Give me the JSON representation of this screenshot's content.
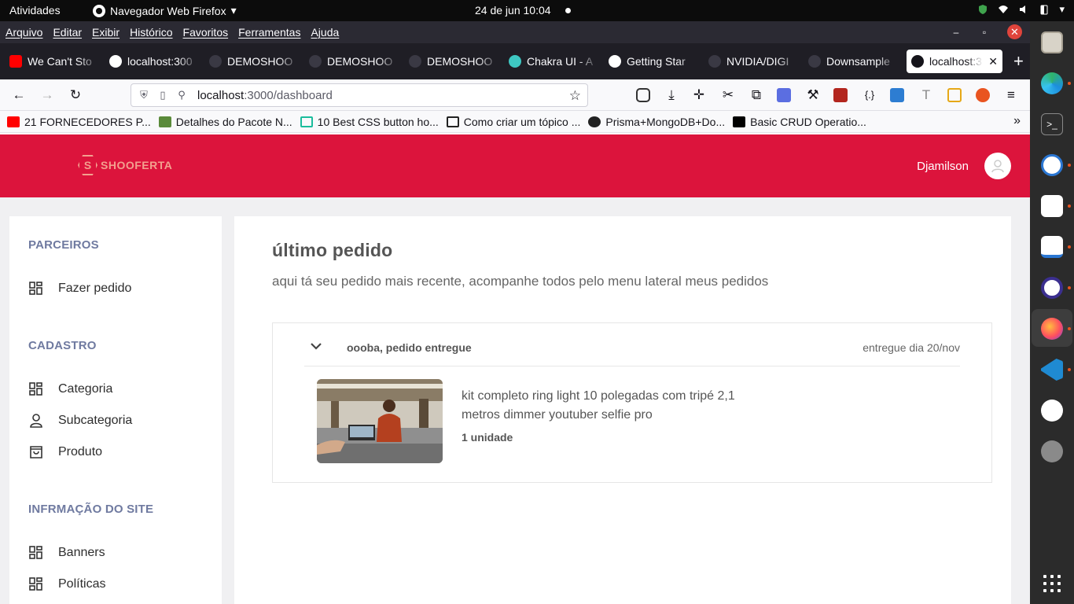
{
  "system": {
    "activities": "Atividades",
    "app_name": "Navegador Web Firefox",
    "clock": "24 de jun  10:04"
  },
  "firefox": {
    "menu": [
      "Arquivo",
      "Editar",
      "Exibir",
      "Histórico",
      "Favoritos",
      "Ferramentas",
      "Ajuda"
    ],
    "tabs": [
      {
        "label": "We Can't Sto",
        "icon": "youtube-icon",
        "color": "#ff0000"
      },
      {
        "label": "localhost:300",
        "icon": "triangle-icon",
        "color": "#ffffff"
      },
      {
        "label": "DEMOSHOO",
        "icon": "github-icon",
        "color": "#3a3944"
      },
      {
        "label": "DEMOSHOO",
        "icon": "github-icon",
        "color": "#3a3944"
      },
      {
        "label": "DEMOSHOO",
        "icon": "github-icon",
        "color": "#3a3944"
      },
      {
        "label": "Chakra UI - A",
        "icon": "chakra-icon",
        "color": "#3ec7c2"
      },
      {
        "label": "Getting Star",
        "icon": "nextjs-icon",
        "color": "#ffffff"
      },
      {
        "label": "NVIDIA/DIGI",
        "icon": "github-icon",
        "color": "#3a3944"
      },
      {
        "label": "Downsample",
        "icon": "github-icon",
        "color": "#3a3944"
      }
    ],
    "active_tab": {
      "label": "localhost:3",
      "icon": "triangle-icon"
    },
    "url": {
      "host": "localhost",
      "path": ":3000/dashboard"
    },
    "bookmarks": [
      {
        "label": "21 FORNECEDORES P...",
        "icon": "youtube-icon",
        "color": "#ff0000"
      },
      {
        "label": "Detalhes do Pacote N...",
        "icon": "package-icon",
        "color": "#5a8a3a"
      },
      {
        "label": "10 Best CSS button ho...",
        "icon": "layout-icon",
        "color": "#1abc9c"
      },
      {
        "label": "Como criar um tópico ...",
        "icon": "notion-icon",
        "color": "#222222"
      },
      {
        "label": "Prisma+MongoDB+Do...",
        "icon": "github-icon",
        "color": "#222222"
      },
      {
        "label": "Basic CRUD Operatio...",
        "icon": "dev-icon",
        "color": "#000000"
      }
    ]
  },
  "site": {
    "brand": "SHOOFERTA",
    "brand_mark": "S",
    "user": "Djamilson",
    "colors": {
      "header": "#dc143c",
      "section_title": "#6f7aa0"
    },
    "sidebar": {
      "sections": [
        {
          "title": "PARCEIROS",
          "items": [
            {
              "label": "Fazer pedido",
              "icon": "grid-icon"
            }
          ]
        },
        {
          "title": "CADASTRO",
          "items": [
            {
              "label": "Categoria",
              "icon": "grid-icon"
            },
            {
              "label": "Subcategoria",
              "icon": "user-icon"
            },
            {
              "label": "Produto",
              "icon": "bag-icon"
            }
          ]
        },
        {
          "title": "INFRMAÇÃO DO SITE",
          "items": [
            {
              "label": "Banners",
              "icon": "grid-icon"
            },
            {
              "label": "Políticas",
              "icon": "grid-icon"
            }
          ]
        }
      ]
    },
    "main": {
      "title": "último pedido",
      "subtitle": "aqui tá seu pedido mais recente, acompanhe todos pelo menu lateral meus pedidos",
      "order": {
        "status": "oooba, pedido entregue",
        "delivered": "entregue dia 20/nov",
        "product": "kit completo ring light 10 polegadas com tripé 2,1 metros dimmer youtuber selfie pro",
        "quantity": "1 unidade"
      }
    }
  }
}
